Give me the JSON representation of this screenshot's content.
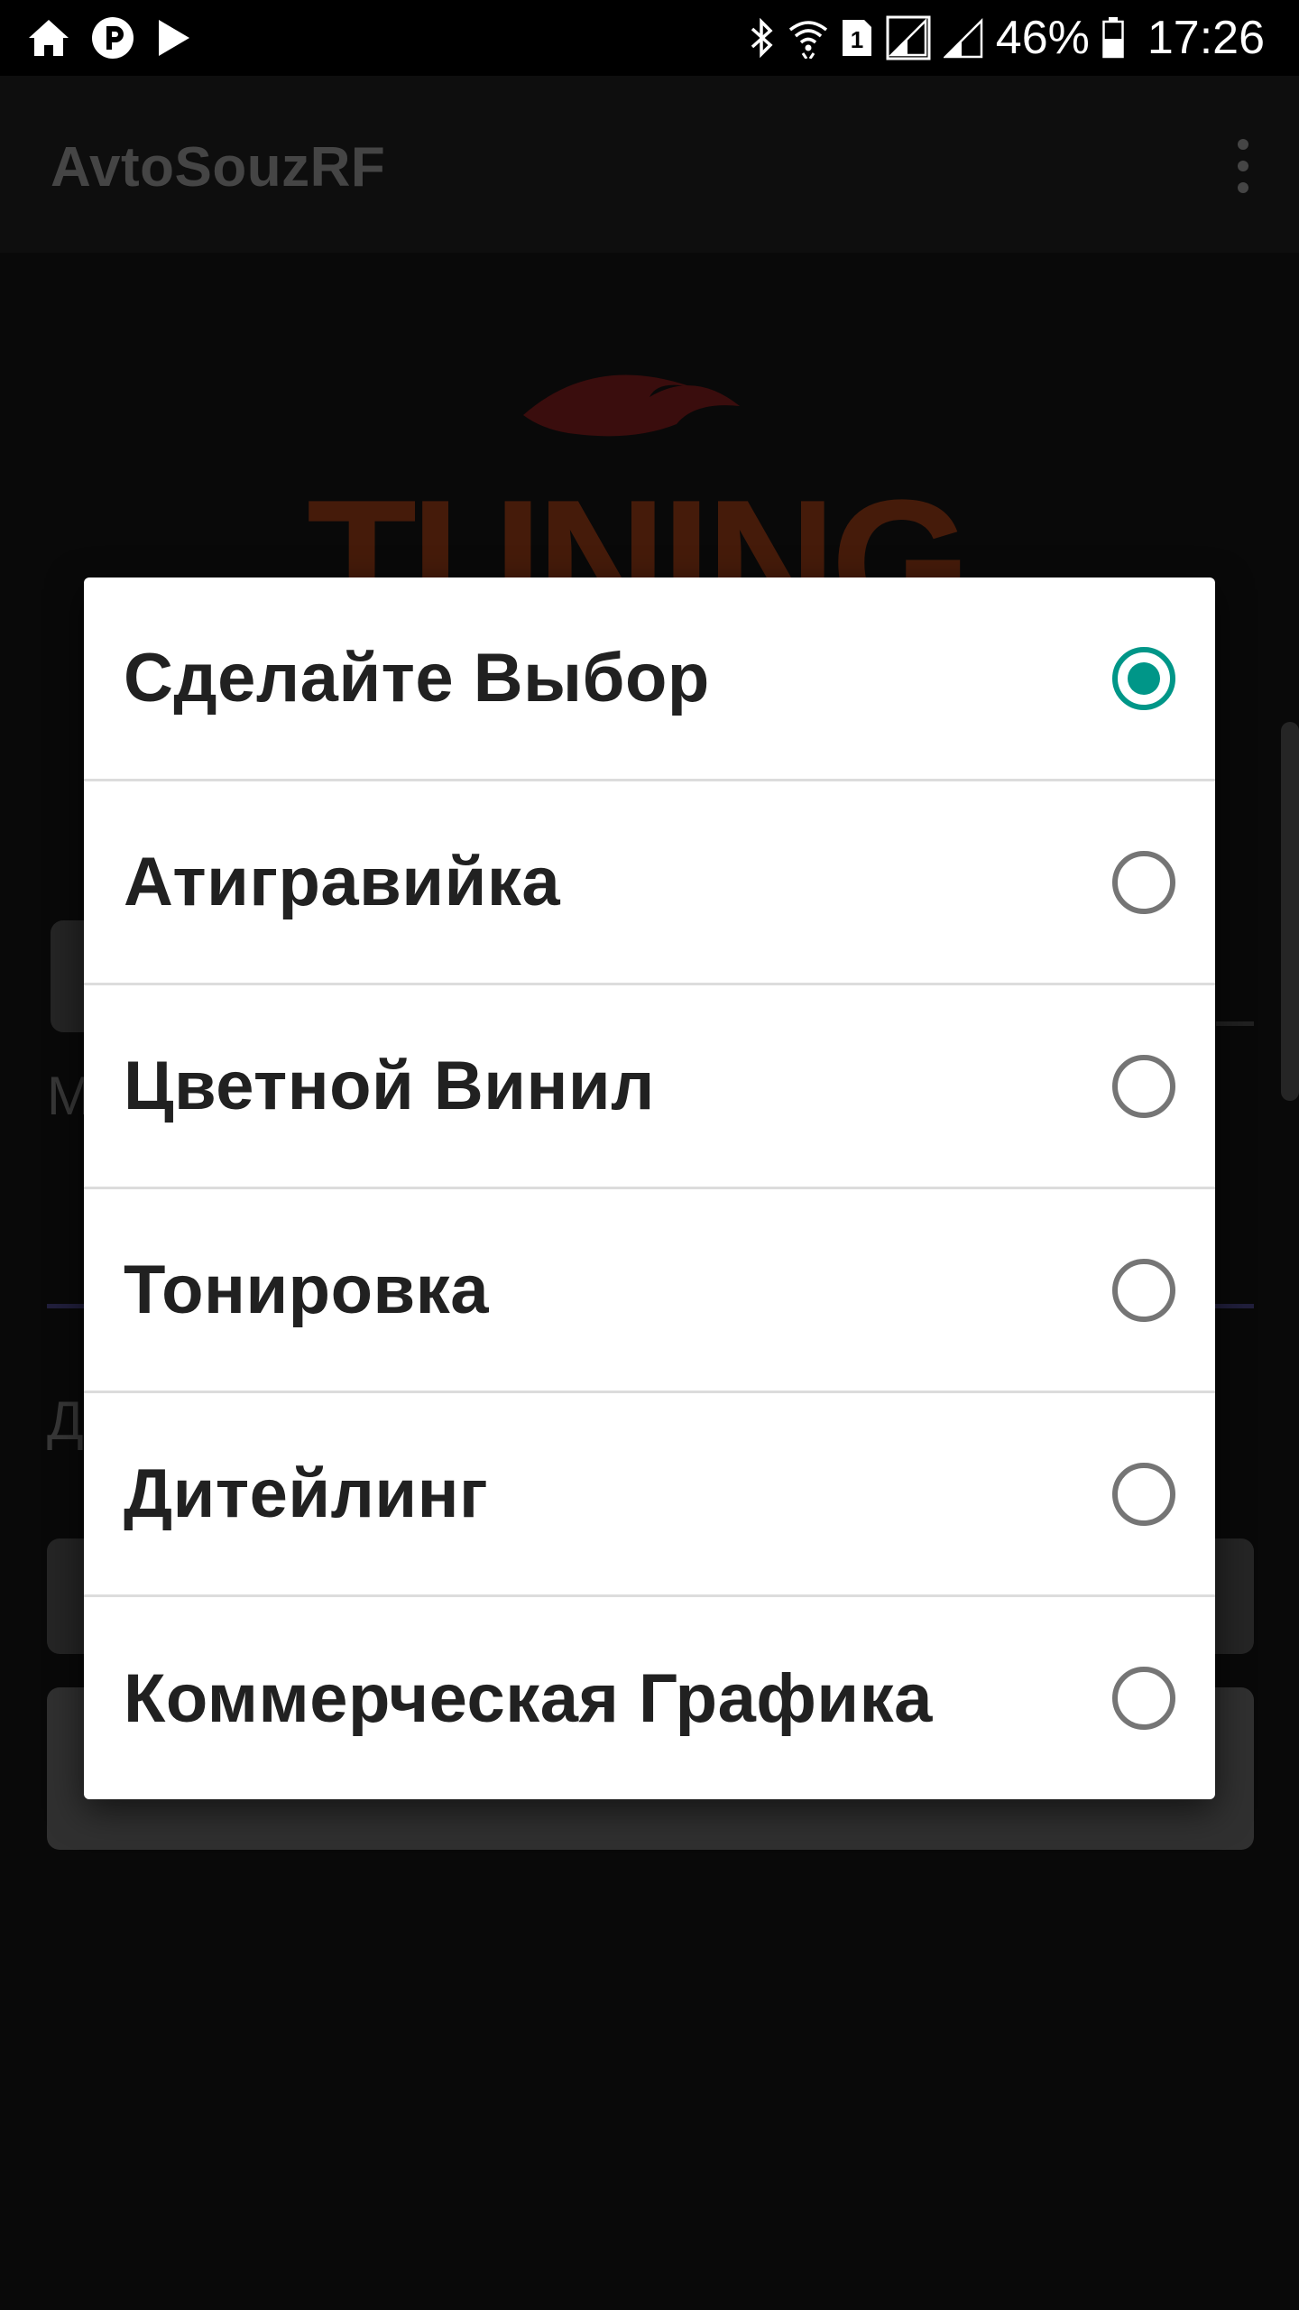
{
  "status_bar": {
    "left_icons": [
      "home-icon",
      "pandora-icon",
      "play-icon"
    ],
    "right_icons": [
      "bluetooth-icon",
      "wifi-icon",
      "sim-1-icon",
      "signal-icon",
      "signal-2-icon",
      "battery-icon"
    ],
    "battery_percent": "46%",
    "time": "17:26"
  },
  "app_bar": {
    "title": "AvtoSouzRF",
    "menu_icon": "overflow-menu-icon"
  },
  "background": {
    "logo_text": "TUNING",
    "label_m": "М",
    "label_d": "Д"
  },
  "dialog": {
    "options": [
      {
        "label": "Сделайте Выбор",
        "selected": true
      },
      {
        "label": "Атигравийка",
        "selected": false
      },
      {
        "label": "Цветной Винил",
        "selected": false
      },
      {
        "label": "Тонировка",
        "selected": false
      },
      {
        "label": "Дитейлинг",
        "selected": false
      },
      {
        "label": "Коммерческая Графика",
        "selected": false
      }
    ]
  },
  "colors": {
    "accent": "#009688",
    "radio_unchecked": "#757575",
    "dialog_bg": "#ffffff",
    "text_primary": "#212121",
    "app_bar_bg": "#161616",
    "status_bar_bg": "#000000"
  }
}
